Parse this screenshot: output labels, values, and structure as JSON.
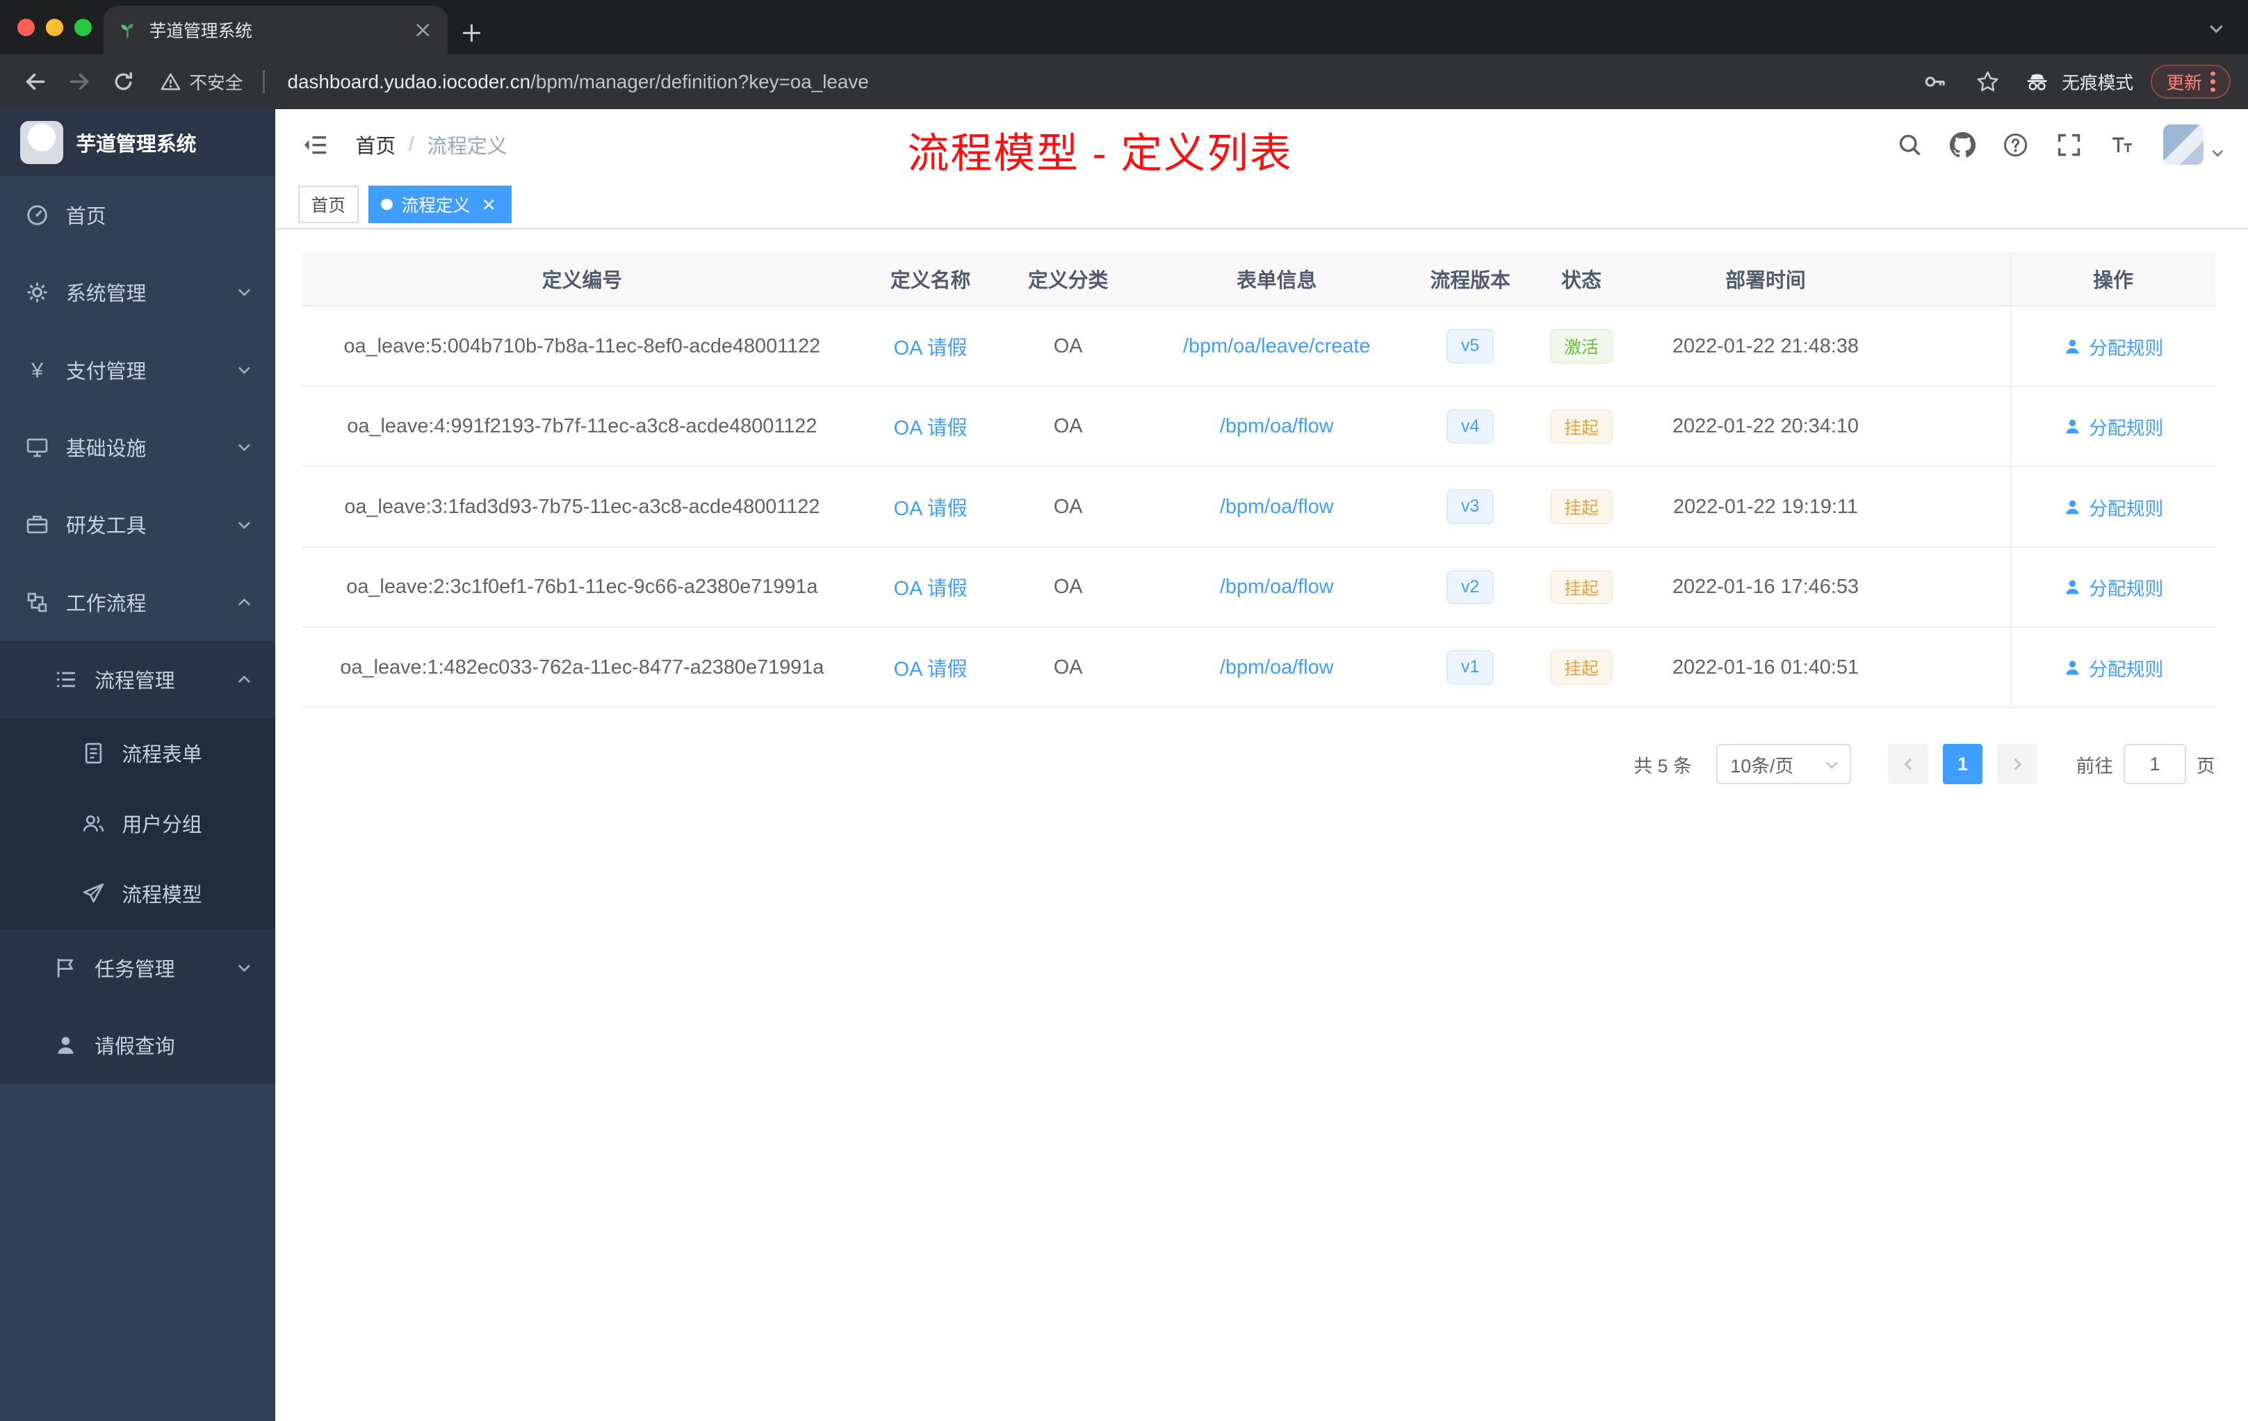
{
  "colors": {
    "accent": "#409eff",
    "success": "#67c23a",
    "warning": "#e6a23c",
    "annotation_red": "#ff1010",
    "sidebar_bg": "#304156"
  },
  "icons": {
    "yen": "¥"
  },
  "browser": {
    "tab_title": "芋道管理系统",
    "security_label": "不安全",
    "url_host": "dashboard.yudao.iocoder.cn",
    "url_path": "/bpm/manager/definition?key=oa_leave",
    "incognito_label": "无痕模式",
    "update_label": "更新"
  },
  "sidebar": {
    "logo_title": "芋道管理系统",
    "items": [
      {
        "label": "首页",
        "icon": "dashboard-icon"
      },
      {
        "label": "系统管理",
        "icon": "gear-icon"
      },
      {
        "label": "支付管理",
        "icon": "yen-icon"
      },
      {
        "label": "基础设施",
        "icon": "monitor-icon"
      },
      {
        "label": "研发工具",
        "icon": "briefcase-icon"
      },
      {
        "label": "工作流程",
        "icon": "workflow-icon"
      },
      {
        "label": "流程管理",
        "icon": "list-icon"
      },
      {
        "label": "流程表单",
        "icon": "form-icon"
      },
      {
        "label": "用户分组",
        "icon": "users-icon"
      },
      {
        "label": "流程模型",
        "icon": "paper-plane-icon"
      },
      {
        "label": "任务管理",
        "icon": "flag-icon"
      },
      {
        "label": "请假查询",
        "icon": "person-icon"
      }
    ]
  },
  "navbar": {
    "breadcrumb_home": "首页",
    "breadcrumb_separator": "/",
    "breadcrumb_current": "流程定义"
  },
  "annotation": {
    "text": "流程模型 - 定义列表"
  },
  "tags": {
    "home": "首页",
    "active": "流程定义"
  },
  "table": {
    "headers": [
      "定义编号",
      "定义名称",
      "定义分类",
      "表单信息",
      "流程版本",
      "状态",
      "部署时间",
      "操作"
    ],
    "rows": [
      {
        "id": "oa_leave:5:004b710b-7b8a-11ec-8ef0-acde48001122",
        "name": "OA 请假",
        "category": "OA",
        "form": "/bpm/oa/leave/create",
        "version": "v5",
        "status": "激活",
        "status_type": "success",
        "deployed_at": "2022-01-22 21:48:38",
        "action": "分配规则"
      },
      {
        "id": "oa_leave:4:991f2193-7b7f-11ec-a3c8-acde48001122",
        "name": "OA 请假",
        "category": "OA",
        "form": "/bpm/oa/flow",
        "version": "v4",
        "status": "挂起",
        "status_type": "warning",
        "deployed_at": "2022-01-22 20:34:10",
        "action": "分配规则"
      },
      {
        "id": "oa_leave:3:1fad3d93-7b75-11ec-a3c8-acde48001122",
        "name": "OA 请假",
        "category": "OA",
        "form": "/bpm/oa/flow",
        "version": "v3",
        "status": "挂起",
        "status_type": "warning",
        "deployed_at": "2022-01-22 19:19:11",
        "action": "分配规则"
      },
      {
        "id": "oa_leave:2:3c1f0ef1-76b1-11ec-9c66-a2380e71991a",
        "name": "OA 请假",
        "category": "OA",
        "form": "/bpm/oa/flow",
        "version": "v2",
        "status": "挂起",
        "status_type": "warning",
        "deployed_at": "2022-01-16 17:46:53",
        "action": "分配规则"
      },
      {
        "id": "oa_leave:1:482ec033-762a-11ec-8477-a2380e71991a",
        "name": "OA 请假",
        "category": "OA",
        "form": "/bpm/oa/flow",
        "version": "v1",
        "status": "挂起",
        "status_type": "warning",
        "deployed_at": "2022-01-16 01:40:51",
        "action": "分配规则"
      }
    ]
  },
  "pagination": {
    "total": "共 5 条",
    "page_size": "10条/页",
    "current_page": "1",
    "goto_label": "前往",
    "goto_value": "1",
    "page_unit": "页"
  }
}
